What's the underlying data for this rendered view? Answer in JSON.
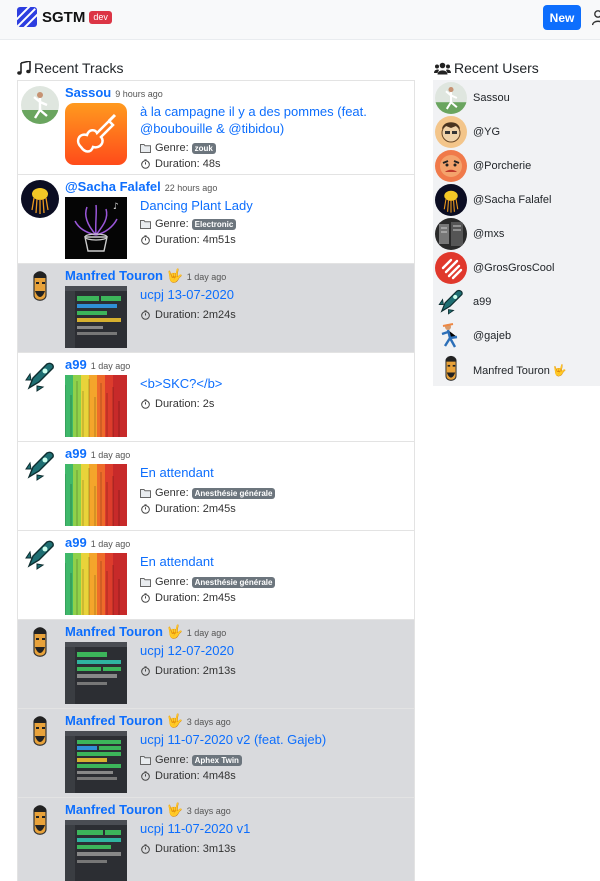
{
  "header": {
    "brand": "SGTM",
    "env_badge": "dev",
    "new_button": "New"
  },
  "recent_tracks": {
    "title": "Recent Tracks",
    "genre_label": "Genre:",
    "duration_label": "Duration:",
    "items": [
      {
        "user": "Sassou",
        "time": "9 hours ago",
        "title": "à la campagne il y a des pommes (feat. @boubouille & @tibidou)",
        "genre": "zouk",
        "duration": "48s"
      },
      {
        "user": "@Sacha Falafel",
        "time": "22 hours ago",
        "title": "Dancing Plant Lady",
        "genre": "Electronic",
        "duration": "4m51s"
      },
      {
        "user": "Manfred Touron 🤟",
        "time": "1 day ago",
        "title": "ucpj 13-07-2020",
        "genre": "",
        "duration": "2m24s"
      },
      {
        "user": "a99",
        "time": "1 day ago",
        "title": "<b>SKC?</b>",
        "genre": "",
        "duration": "2s"
      },
      {
        "user": "a99",
        "time": "1 day ago",
        "title": "En attendant",
        "genre": "Anesthésie générale",
        "duration": "2m45s"
      },
      {
        "user": "a99",
        "time": "1 day ago",
        "title": "En attendant",
        "genre": "Anesthésie générale",
        "duration": "2m45s"
      },
      {
        "user": "Manfred Touron 🤟",
        "time": "1 day ago",
        "title": "ucpj 12-07-2020",
        "genre": "",
        "duration": "2m13s"
      },
      {
        "user": "Manfred Touron 🤟",
        "time": "3 days ago",
        "title": "ucpj 11-07-2020 v2 (feat. Gajeb)",
        "genre": "Aphex Twin",
        "duration": "4m48s"
      },
      {
        "user": "Manfred Touron 🤟",
        "time": "3 days ago",
        "title": "ucpj 11-07-2020 v1",
        "genre": "",
        "duration": "3m13s"
      }
    ]
  },
  "recent_users": {
    "title": "Recent Users",
    "items": [
      "Sassou",
      "@YG",
      "@Porcherie",
      "@Sacha Falafel",
      "@mxs",
      "@GrosGrosCool",
      "a99",
      "@gajeb",
      "Manfred Touron 🤟"
    ]
  },
  "colors": {
    "accent": "#0d6efd",
    "badge_dev": "#dc3545",
    "badge_genre": "#6c757d",
    "row_highlight": "#d9dadd"
  }
}
